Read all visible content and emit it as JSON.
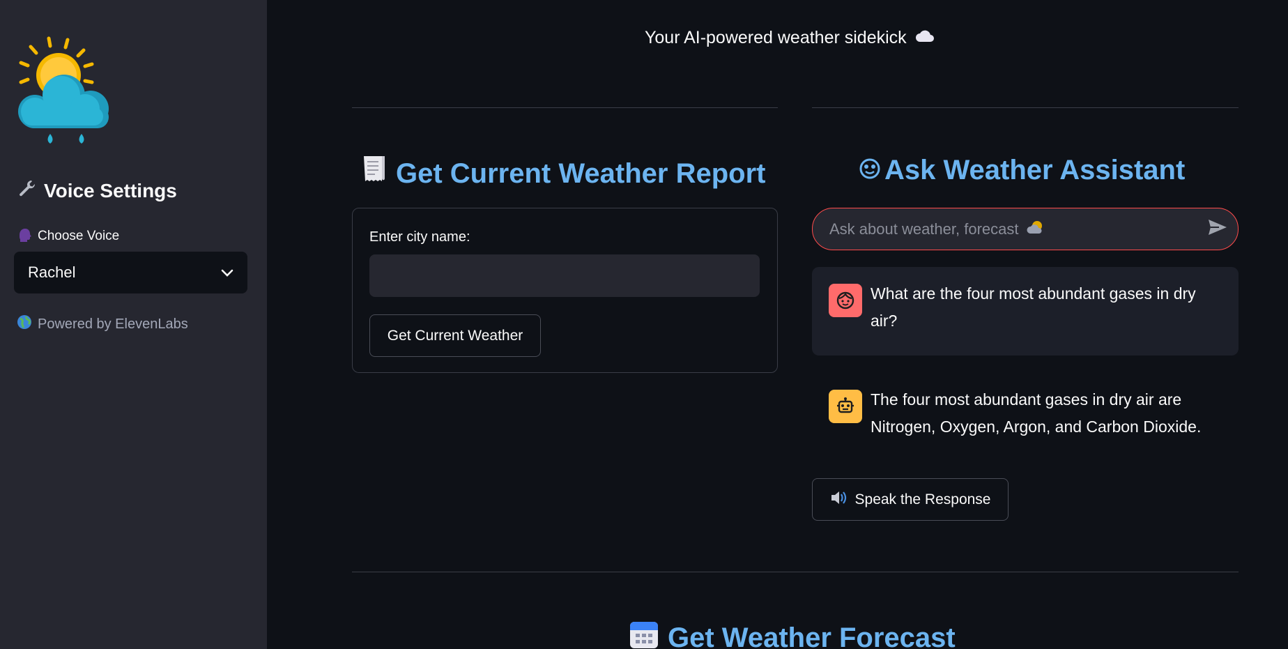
{
  "tagline": {
    "text": "Your AI-powered weather sidekick",
    "icon": "cloud-icon"
  },
  "sidebar": {
    "title": "Voice Settings",
    "title_icon": "wrench-icon",
    "choose_label": "Choose Voice",
    "choose_icon": "speaking-head-icon",
    "selected_voice": "Rachel",
    "powered_by": "Powered by ElevenLabs",
    "powered_icon": "globe-icon"
  },
  "report": {
    "heading": "Get Current Weather Report",
    "heading_icon": "receipt-icon",
    "city_label": "Enter city name:",
    "city_value": "",
    "button_label": "Get Current Weather"
  },
  "assistant": {
    "heading": "Ask Weather Assistant",
    "heading_icon": "smiley-icon",
    "placeholder": "Ask about weather, forecast",
    "placeholder_icon": "sun-behind-cloud-icon",
    "messages": [
      {
        "role": "user",
        "text": "What are the four most abundant gases in dry air?"
      },
      {
        "role": "assistant",
        "text": "The four most abundant gases in dry air are Nitrogen, Oxygen, Argon, and Carbon Dioxide."
      }
    ],
    "speak_button": "Speak the Response",
    "speak_icon": "speaker-icon"
  },
  "forecast": {
    "heading": "Get Weather Forecast",
    "heading_icon": "calendar-icon"
  },
  "colors": {
    "accent_heading": "#6cb4f0",
    "error_border": "#ff4b4b",
    "user_avatar": "#ff6b6b",
    "bot_avatar": "#ffbd45"
  }
}
